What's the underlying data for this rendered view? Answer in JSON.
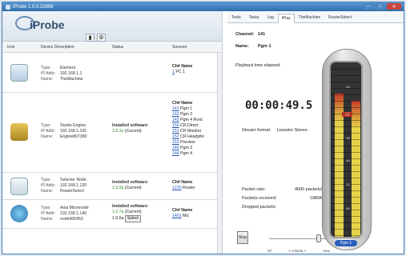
{
  "window": {
    "title": "iProbe 1.0.0.32698"
  },
  "app": {
    "logo_text": "iProbe"
  },
  "table": {
    "headers": [
      "Icon",
      "Device Description",
      "Status",
      "Sources"
    ],
    "rows": [
      {
        "icon": "element-icon",
        "type": "Element",
        "ip": "192.168.1.1",
        "name": "TheMachine",
        "status_head": "",
        "status_ver": "",
        "status_cur": "",
        "sources": [
          {
            "ch": "1",
            "name": "PC 1"
          }
        ]
      },
      {
        "icon": "studio-engine-icon",
        "type": "Studio Engine",
        "ip": "192.168.1.105",
        "name": "Engine807380",
        "status_head": "Installed software:",
        "status_ver": "2.6.1e",
        "status_cur": "(Current)",
        "sources": [
          {
            "ch": "141",
            "name": "Pgm 1"
          },
          {
            "ch": "142",
            "name": "Pgm 2"
          },
          {
            "ch": "143",
            "name": "Pgm 4 Rvrd"
          },
          {
            "ch": "150",
            "name": "CR Direct"
          },
          {
            "ch": "151",
            "name": "CR Monitor"
          },
          {
            "ch": "152",
            "name": "CR Headphn"
          },
          {
            "ch": "153",
            "name": "Preview"
          },
          {
            "ch": "140",
            "name": "Pgm 3"
          },
          {
            "ch": "144",
            "name": "Pgm 4"
          }
        ]
      },
      {
        "icon": "selector-node-icon",
        "type": "Selector Node",
        "ip": "192.168.1.120",
        "name": "RouterSelect",
        "status_head": "Installed software:",
        "status_ver": "2.3.2g",
        "status_cur": "(Current)",
        "sources": [
          {
            "ch": "1210",
            "name": "Router"
          }
        ]
      },
      {
        "icon": "axia-micronode-icon",
        "type": "Axia Micronode",
        "ip": "192.168.1.140",
        "name": "node900453",
        "status_head": "Installed software:",
        "status_ver": "1.0.7a",
        "status_cur": "(Current)",
        "status_extra": "1.0.6a",
        "status_button": "Select",
        "sources": [
          {
            "ch": "1401",
            "name": "Mic"
          }
        ]
      }
    ],
    "labels": {
      "type": "Type:",
      "ip": "IP Addr:",
      "name": "Name:",
      "ch_head": "Ch#",
      "name_head": "Name"
    }
  },
  "right": {
    "tabs": [
      "Tools",
      "Tasks",
      "Log",
      "iPlay",
      "TheMachine",
      "RouterSelect"
    ],
    "active_tab": "iPlay",
    "channel_label": "Channel:",
    "channel_value": "141",
    "name_label": "Name:",
    "name_value": "Pgm 1",
    "elapsed_label": "Playback time elapsed:",
    "elapsed_value": "00:00:49.5",
    "stream_label": "Stream format:",
    "stream_value": "Livewire Stereo",
    "packet_rate_label": "Packet rate:",
    "packet_rate_value": "4000 packets/s",
    "packets_received_label": "Packets received:",
    "packets_received_value": "198040",
    "dropped_label": "Dropped packets:",
    "dropped_value": "0",
    "stop_label": "Stop",
    "volume_min": "inf",
    "volume_mid": "< volume >",
    "volume_max": "max",
    "volume_level": 0.9,
    "meter_label": "Pgm 1",
    "meter_level_left": 0.82,
    "meter_level_right": 0.78,
    "meter_scale": [
      "-10",
      "-20",
      "-30",
      "-40",
      "-50",
      "-60"
    ],
    "meter_zero": "-20"
  },
  "colors": {
    "accent": "#2e6eaa",
    "link": "#2050b8",
    "ok": "#2f8a33",
    "meter_yellow": "#e6d24a",
    "meter_red": "#c83a2a"
  }
}
